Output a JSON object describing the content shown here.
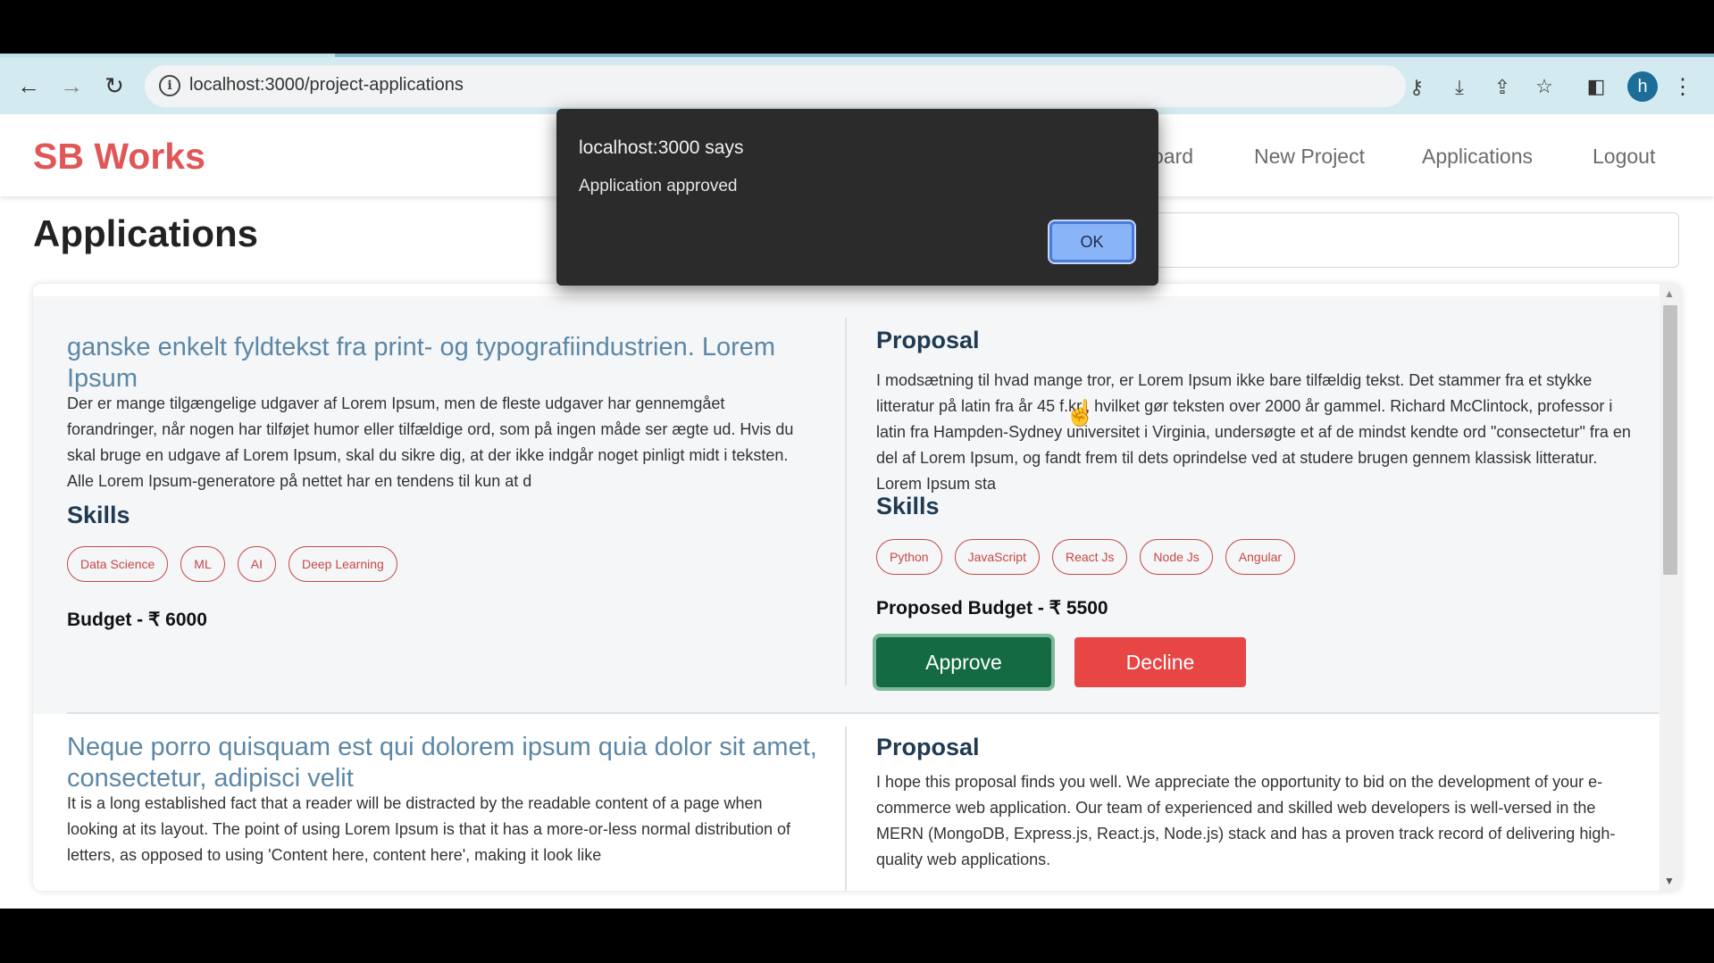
{
  "browser": {
    "url": "localhost:3000/project-applications",
    "avatar_letter": "h",
    "icons": [
      "back-icon",
      "forward-icon",
      "reload-icon",
      "info-icon",
      "key-icon",
      "install-icon",
      "share-icon",
      "star-icon",
      "sidepanel-icon",
      "menu-icon"
    ]
  },
  "navbar": {
    "brand": "SB Works",
    "links": [
      "oard",
      "New Project",
      "Applications",
      "Logout"
    ]
  },
  "page": {
    "title": "Applications"
  },
  "applications": [
    {
      "title": "ganske enkelt fyldtekst fra print- og typografiindustrien. Lorem Ipsum",
      "description": "Der er mange tilgængelige udgaver af Lorem Ipsum, men de fleste udgaver har gennemgået forandringer, når nogen har tilføjet humor eller tilfældige ord, som på ingen måde ser ægte ud. Hvis du skal bruge en udgave af Lorem Ipsum, skal du sikre dig, at der ikke indgår noget pinligt midt i teksten. Alle Lorem Ipsum-generatore på nettet har en tendens til kun at d",
      "skills_heading": "Skills",
      "skills": [
        "Data Science",
        "ML",
        "AI",
        "Deep Learning"
      ],
      "budget": "Budget - ₹ 6000",
      "proposal_heading": "Proposal",
      "proposal": "I modsætning til hvad mange tror, er Lorem Ipsum ikke bare tilfældig tekst. Det stammer fra et stykke litteratur på latin fra år 45 f.kr., hvilket gør teksten over 2000 år gammel. Richard McClintock, professor i latin fra Hampden-Sydney universitet i Virginia, undersøgte et af de mindst kendte ord \"consectetur\" fra en del af Lorem Ipsum, og fandt frem til dets oprindelse ved at studere brugen gennem klassisk litteratur. Lorem Ipsum sta",
      "applicant_skills_heading": "Skills",
      "applicant_skills": [
        "Python",
        "JavaScript",
        "React Js",
        "Node Js",
        "Angular"
      ],
      "proposed_budget": "Proposed Budget - ₹ 5500",
      "approve_label": "Approve",
      "decline_label": "Decline"
    },
    {
      "title": "Neque porro quisquam est qui dolorem ipsum quia dolor sit amet, consectetur, adipisci velit",
      "description": "It is a long established fact that a reader will be distracted by the readable content of a page when looking at its layout. The point of using Lorem Ipsum is that it has a more-or-less normal distribution of letters, as opposed to using 'Content here, content here', making it look like",
      "proposal_heading": "Proposal",
      "proposal": "I hope this proposal finds you well. We appreciate the opportunity to bid on the development of your e-commerce web application. Our team of experienced and skilled web developers is well-versed in the MERN (MongoDB, Express.js, React.js, Node.js) stack and has a proven track record of delivering high-quality web applications."
    }
  ],
  "dialog": {
    "title": "localhost:3000 says",
    "message": "Application approved",
    "ok_label": "OK"
  },
  "colors": {
    "brand": "#e05757",
    "approve": "#146b43",
    "decline": "#e84545",
    "project_title": "#5c87a6"
  }
}
